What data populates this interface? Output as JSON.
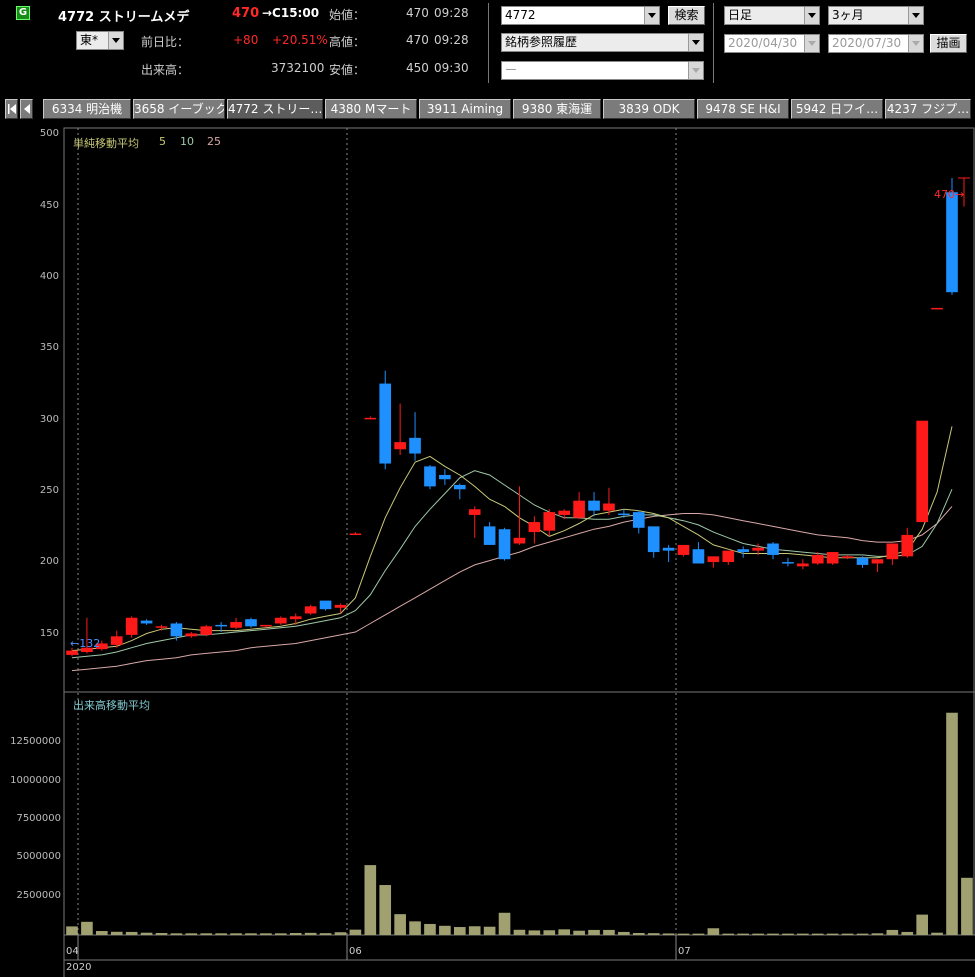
{
  "header": {
    "market_badge": "G",
    "stock_title": "4772 ストリームメデ",
    "last_price": "470",
    "last_time_label": "→C15:00",
    "exchange_select": "東*",
    "prev_change_label": "前日比：",
    "change_value": "+80",
    "change_pct": "+20.51%",
    "volume_label": "出来高：",
    "volume_value": "3732100",
    "open_label": "始値：",
    "open_value": "470",
    "open_time": "09:28",
    "high_label": "高値：",
    "high_value": "470",
    "high_time": "09:28",
    "low_label": "安値：",
    "low_value": "450",
    "low_time": "09:30"
  },
  "search": {
    "code_value": "4772",
    "search_button": "検索",
    "history_select": "銘柄参照履歴",
    "third_select": "ー"
  },
  "period": {
    "interval_select": "日足",
    "range_select": "3ヶ月",
    "from_date": "2020/04/30",
    "to_date": "2020/07/30",
    "draw_button": "描画"
  },
  "tabs": [
    "6334 明治機",
    "3658 イーブック",
    "4772 ストリー…",
    "4380 Mマート",
    "3911 Aiming",
    "9380 東海運",
    "3839 ODK",
    "9478 SE  H&I",
    "5942 日フイ…",
    "4237 フジプ…"
  ],
  "colors": {
    "up": "#ff1a1a",
    "down": "#1e90ff",
    "ma5": "#c8c878",
    "ma10": "#9ec8a8",
    "ma25": "#d8a8a8",
    "volume": "#a0a070",
    "volume_ma": "#7fc8d0"
  },
  "price_chart": {
    "title": "単純移動平均",
    "ma_labels": [
      "5",
      "10",
      "25"
    ],
    "y_ticks": [
      150,
      200,
      250,
      300,
      350,
      400,
      450,
      500
    ],
    "ylim": [
      110,
      505
    ],
    "start_marker": "←132",
    "end_marker": "470→"
  },
  "volume_chart": {
    "title": "出来高移動平均",
    "y_ticks": [
      "2500000",
      "5000000",
      "7500000",
      "10000000",
      "12500000"
    ],
    "ymax": 15200000
  },
  "x_axis": {
    "month_labels": [
      "04",
      "06",
      "07"
    ],
    "year_label": "2020"
  },
  "chart_data": {
    "type": "candlestick",
    "categories_count": 60,
    "ohlc": [
      [
        136,
        141,
        135,
        139
      ],
      [
        138,
        162,
        137,
        141
      ],
      [
        140,
        146,
        139,
        144
      ],
      [
        143,
        153,
        141,
        149
      ],
      [
        150,
        163,
        148,
        162
      ],
      [
        160,
        161,
        157,
        158
      ],
      [
        155,
        157,
        153,
        156
      ],
      [
        158,
        159,
        146,
        149
      ],
      [
        149,
        152,
        148,
        151
      ],
      [
        150,
        157,
        149,
        156
      ],
      [
        157,
        159,
        152,
        156
      ],
      [
        155,
        162,
        154,
        159
      ],
      [
        161,
        162,
        155,
        156
      ],
      [
        157,
        157,
        155,
        157
      ],
      [
        158,
        163,
        157,
        162
      ],
      [
        161,
        165,
        157,
        163
      ],
      [
        165,
        171,
        164,
        170
      ],
      [
        174,
        174,
        167,
        168
      ],
      [
        169,
        172,
        165,
        171
      ],
      [
        221,
        222,
        220,
        221
      ],
      [
        302,
        303,
        301,
        302
      ],
      [
        326,
        335,
        266,
        270
      ],
      [
        280,
        312,
        276,
        285
      ],
      [
        288,
        306,
        272,
        277
      ],
      [
        268,
        269,
        252,
        254
      ],
      [
        262,
        266,
        255,
        259
      ],
      [
        255,
        256,
        245,
        252
      ],
      [
        234,
        240,
        218,
        238
      ],
      [
        226,
        229,
        214,
        213
      ],
      [
        224,
        225,
        202,
        203
      ],
      [
        214,
        254,
        213,
        218
      ],
      [
        222,
        233,
        214,
        229
      ],
      [
        223,
        238,
        219,
        236
      ],
      [
        234,
        238,
        231,
        237
      ],
      [
        232,
        250,
        231,
        244
      ],
      [
        244,
        250,
        233,
        237
      ],
      [
        237,
        253,
        234,
        242
      ],
      [
        235,
        238,
        232,
        234
      ],
      [
        236,
        237,
        221,
        225
      ],
      [
        226,
        226,
        204,
        208
      ],
      [
        211,
        213,
        201,
        209
      ],
      [
        206,
        210,
        205,
        213
      ],
      [
        210,
        215,
        204,
        200
      ],
      [
        201,
        204,
        197,
        205
      ],
      [
        201,
        206,
        199,
        209
      ],
      [
        210,
        212,
        204,
        208
      ],
      [
        209,
        214,
        206,
        211
      ],
      [
        214,
        215,
        203,
        206
      ],
      [
        201,
        204,
        198,
        200
      ],
      [
        198,
        203,
        196,
        200
      ],
      [
        200,
        208,
        199,
        206
      ],
      [
        200,
        207,
        199,
        208
      ],
      [
        205,
        206,
        203,
        205
      ],
      [
        204,
        205,
        197,
        199
      ],
      [
        200,
        201,
        194,
        203
      ],
      [
        203,
        214,
        199,
        214
      ],
      [
        205,
        225,
        204,
        220
      ],
      [
        229,
        300,
        229,
        300
      ],
      [
        378,
        379,
        378,
        379
      ],
      [
        460,
        470,
        388,
        390
      ]
    ],
    "volume": [
      560000,
      860000,
      260000,
      210000,
      200000,
      150000,
      130000,
      110000,
      110000,
      110000,
      110000,
      110000,
      110000,
      110000,
      110000,
      130000,
      140000,
      120000,
      180000,
      350000,
      4560000,
      3260000,
      1360000,
      890000,
      720000,
      600000,
      520000,
      570000,
      540000,
      1450000,
      340000,
      300000,
      310000,
      370000,
      280000,
      330000,
      330000,
      200000,
      130000,
      120000,
      100000,
      90000,
      90000,
      440000,
      90000,
      90000,
      90000,
      90000,
      90000,
      90000,
      90000,
      90000,
      90000,
      90000,
      110000,
      330000,
      200000,
      1330000,
      150000,
      14500000
    ],
    "last_volume": 3732100,
    "ma5": [
      139,
      140,
      141,
      142,
      146,
      151,
      154,
      155,
      154,
      153,
      153,
      153,
      154,
      155,
      156,
      158,
      161,
      163,
      165,
      176,
      205,
      232,
      253,
      271,
      275,
      268,
      262,
      254,
      245,
      240,
      232,
      226,
      219,
      223,
      228,
      234,
      236,
      238,
      237,
      235,
      232,
      226,
      220,
      213,
      210,
      207,
      207,
      207,
      207,
      206,
      205,
      204,
      204,
      204,
      204,
      206,
      209,
      224,
      250,
      296
    ],
    "ma10": [
      134,
      135,
      136,
      138,
      141,
      144,
      146,
      148,
      150,
      150,
      151,
      152,
      153,
      154,
      155,
      156,
      158,
      160,
      162,
      167,
      178,
      195,
      210,
      226,
      238,
      249,
      260,
      265,
      262,
      255,
      248,
      241,
      236,
      232,
      232,
      231,
      231,
      233,
      234,
      234,
      232,
      230,
      227,
      222,
      218,
      214,
      212,
      210,
      209,
      208,
      207,
      206,
      206,
      206,
      205,
      205,
      206,
      212,
      228,
      252
    ],
    "ma25": [
      125,
      126,
      127,
      128,
      130,
      132,
      133,
      134,
      136,
      137,
      138,
      139,
      141,
      142,
      143,
      144,
      146,
      148,
      150,
      152,
      158,
      164,
      170,
      176,
      182,
      188,
      194,
      199,
      202,
      205,
      208,
      212,
      215,
      218,
      221,
      224,
      226,
      229,
      231,
      233,
      234,
      235,
      235,
      234,
      232,
      230,
      228,
      226,
      224,
      222,
      220,
      219,
      218,
      216,
      215,
      215,
      216,
      220,
      228,
      240
    ]
  }
}
